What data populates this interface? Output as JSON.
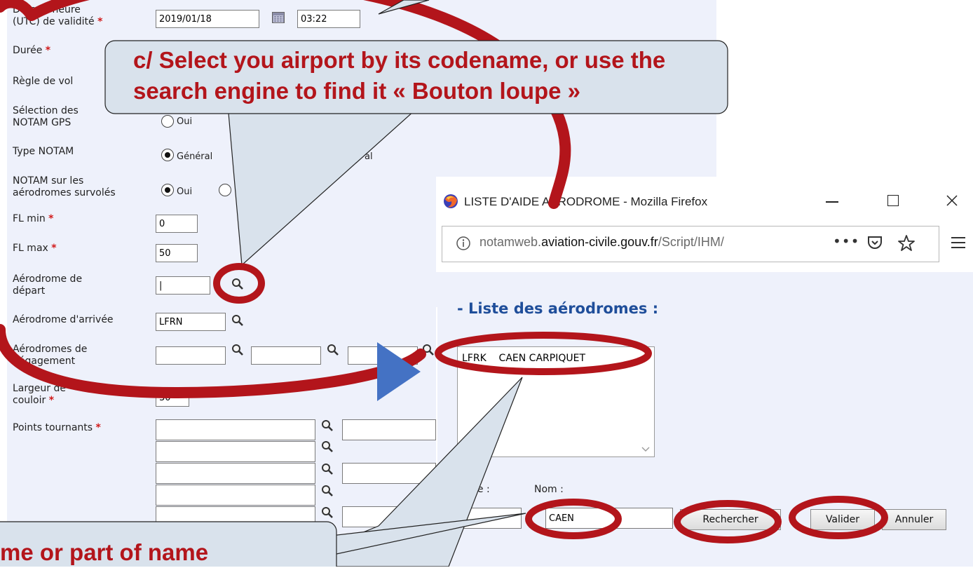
{
  "form": {
    "date_label_1": "Date et heure",
    "date_label_2": "(UTC) de validité",
    "required_mark": "*",
    "date_value": "2019/01/18",
    "time_value": "03:22",
    "duree_label": "Durée",
    "regle_label": "Règle de vol",
    "gps_label_1": "Sélection des",
    "gps_label_2": "NOTAM GPS",
    "gps_oui": "Oui",
    "type_label": "Type NOTAM",
    "type_general": "Général",
    "type_frag": "al",
    "survoles_label_1": "NOTAM sur les",
    "survoles_label_2": "aérodromes survolés",
    "survoles_oui": "Oui",
    "fl_min_label": "FL min",
    "fl_min_value": "0",
    "fl_max_label": "FL max",
    "fl_max_value": "50",
    "depart_label_1": "Aérodrome de",
    "depart_label_2": "départ",
    "depart_value": "|",
    "arrivee_label": "Aérodrome d'arrivée",
    "arrivee_value": "LFRN",
    "degagement_label_1": "Aérodromes de",
    "degagement_label_2": "dégagement",
    "largeur_label_1": "Largeur de",
    "largeur_label_2": "couloir",
    "largeur_value": "30",
    "points_label": "Points tournants"
  },
  "popup": {
    "window_title": "LISTE D'AIDE AERODROME - Mozilla Firefox",
    "url_host_prefix": "notamweb.",
    "url_host_domain": "aviation-civile.gouv.fr",
    "url_path": "/Script/IHM/",
    "list_heading": "- Liste des aérodromes :",
    "list_items": [
      "LFRK    CAEN CARPIQUET"
    ],
    "code_label": "de :",
    "nom_label": "Nom :",
    "nom_value": "CAEN",
    "search_button": "Rechercher",
    "validate_button": "Valider",
    "cancel_button": "Annuler"
  },
  "callouts": {
    "top_line_1": "c/ Select you airport by its codename, or use the",
    "top_line_2": "search engine to find it « Bouton loupe »",
    "bottom_text": "me or part of name"
  },
  "colors": {
    "annotation_red": "#b3151b",
    "callout_fill": "#d9e2ec",
    "form_bg": "#eef1fb",
    "heading_blue": "#1f4e9a",
    "arrow_blue": "#4472c4"
  },
  "icons": [
    "magnifier-icon",
    "calendar-icon",
    "firefox-icon",
    "info-icon",
    "pocket-icon",
    "star-icon",
    "hamburger-menu-icon",
    "minimize-icon",
    "maximize-icon",
    "close-icon",
    "chevron-down-icon"
  ]
}
